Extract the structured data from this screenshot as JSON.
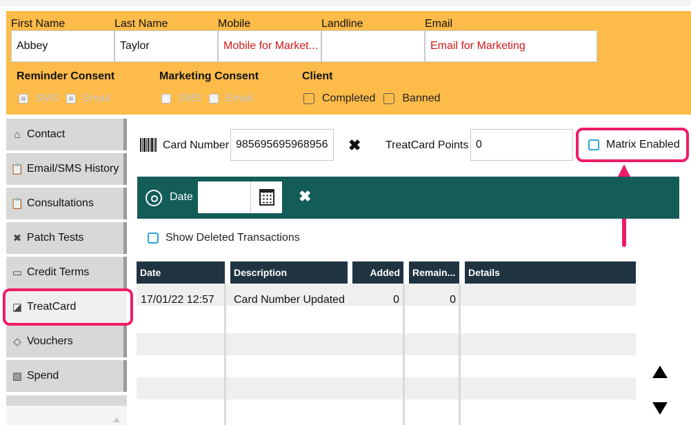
{
  "header": {
    "fields": {
      "first_name": {
        "label": "First Name",
        "value": "Abbey"
      },
      "last_name": {
        "label": "Last Name",
        "value": "Taylor"
      },
      "mobile": {
        "label": "Mobile",
        "value": "Mobile for Market..."
      },
      "landline": {
        "label": "Landline",
        "value": ""
      },
      "email": {
        "label": "Email",
        "value": "Email for Marketing"
      }
    },
    "reminder_consent": {
      "title": "Reminder Consent",
      "sms": "SMS",
      "email": "Email"
    },
    "marketing_consent": {
      "title": "Marketing Consent",
      "sms": "SMS",
      "email": "Email"
    },
    "client": {
      "title": "Client",
      "completed": "Completed",
      "banned": "Banned"
    }
  },
  "nav": {
    "items": [
      {
        "label": "Contact",
        "icon": "home-icon"
      },
      {
        "label": "Email/SMS History",
        "icon": "clipboard-icon"
      },
      {
        "label": "Consultations",
        "icon": "clipboard-icon"
      },
      {
        "label": "Patch Tests",
        "icon": "bandage-icon"
      },
      {
        "label": "Credit Terms",
        "icon": "credit-card-icon"
      },
      {
        "label": "TreatCard",
        "icon": "card-icon"
      },
      {
        "label": "Vouchers",
        "icon": "tag-icon"
      },
      {
        "label": "Spend",
        "icon": "chart-icon"
      }
    ],
    "active": "TreatCard"
  },
  "card": {
    "number_label": "Card Number",
    "number_value": "985695695968956",
    "points_label": "TreatCard Points",
    "points_value": "0",
    "matrix_label": "Matrix Enabled"
  },
  "filter": {
    "date_label": "Date",
    "date_value": ""
  },
  "show_deleted_label": "Show Deleted Transactions",
  "table": {
    "columns": [
      "Date",
      "Description",
      "Added",
      "Remain...",
      "Details"
    ],
    "rows": [
      {
        "date": "17/01/22 12:57",
        "description": "Card Number Updated",
        "added": "0",
        "remaining": "0",
        "details": ""
      }
    ]
  },
  "colors": {
    "header_bg": "#fdbb4a",
    "teal_bar": "#145c58",
    "table_head": "#1f3440",
    "annotation": "#ee1c68"
  }
}
